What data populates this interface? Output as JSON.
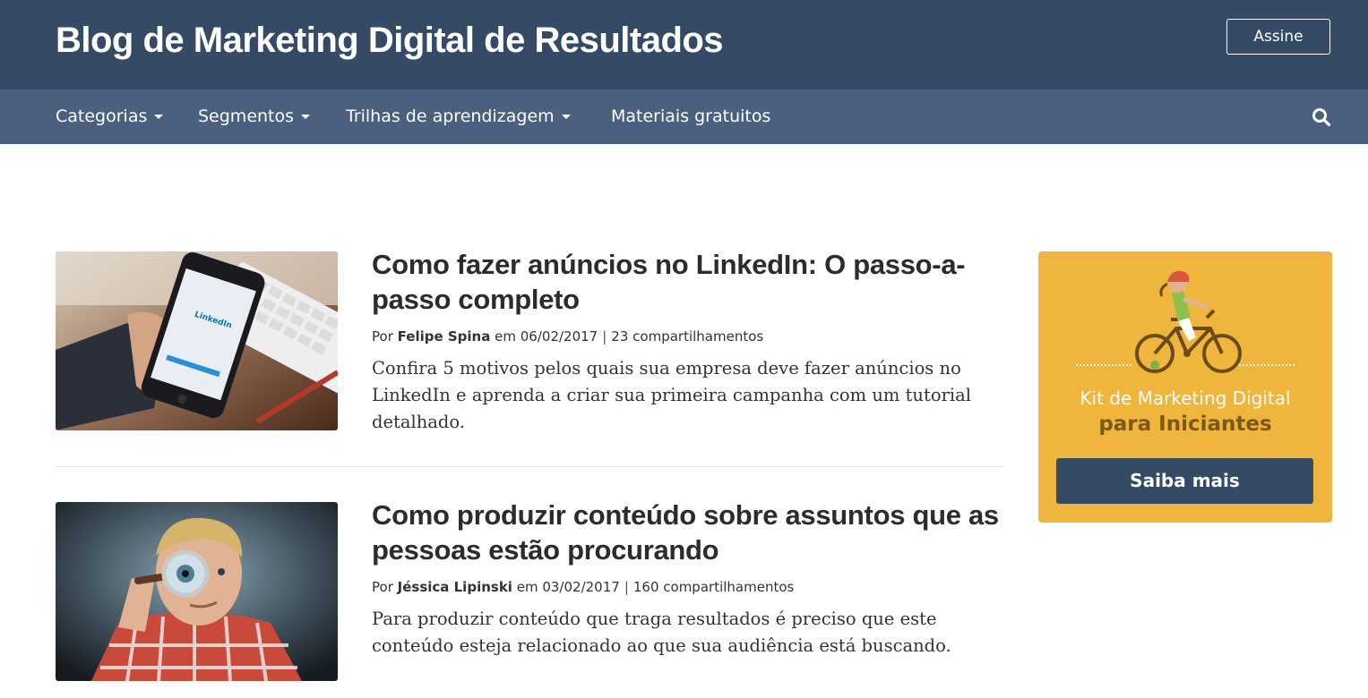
{
  "header": {
    "blog_title": "Blog de Marketing Digital de Resultados",
    "subscribe_label": "Assine"
  },
  "nav": {
    "items": [
      {
        "label": "Categorias",
        "has_dropdown": true
      },
      {
        "label": "Segmentos",
        "has_dropdown": true
      },
      {
        "label": "Trilhas de aprendizagem",
        "has_dropdown": true
      },
      {
        "label": "Materiais gratuitos",
        "has_dropdown": false
      }
    ],
    "search_icon": "search-icon"
  },
  "posts": [
    {
      "title": "Como fazer anúncios no LinkedIn: O passo-a-passo completo",
      "by_label": "Por",
      "author": "Felipe Spina",
      "date_prefix": "em",
      "date": "06/02/2017",
      "separator": "|",
      "shares": "23 compartilhamentos",
      "excerpt": "Confira 5 motivos pelos quais sua empresa deve fazer anúncios no LinkedIn e aprenda a criar sua primeira campanha com um tutorial detalhado.",
      "image_text": "LinkedIn"
    },
    {
      "title": "Como produzir conteúdo sobre assuntos que as pessoas estão procurando",
      "by_label": "Por",
      "author": "Jéssica Lipinski",
      "date_prefix": "em",
      "date": "03/02/2017",
      "separator": "|",
      "shares": "160 compartilhamentos",
      "excerpt": "Para produzir conteúdo que traga resultados é preciso que este conteúdo esteja relacionado ao que sua audiência está buscando."
    }
  ],
  "sidebar": {
    "promo": {
      "line1": "Kit de Marketing Digital",
      "line2": "para Iniciantes",
      "button_label": "Saiba mais",
      "background_color": "#efb53c",
      "button_color": "#354a65"
    }
  },
  "colors": {
    "topbar": "#354a65",
    "navbar": "#4a607e"
  }
}
